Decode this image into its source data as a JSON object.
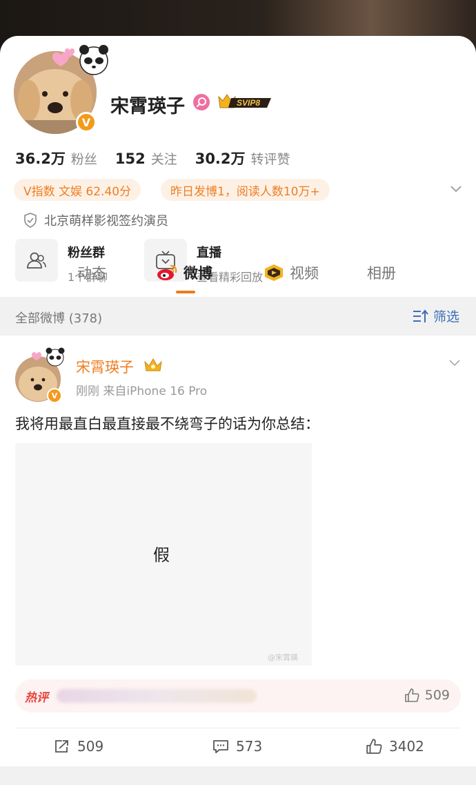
{
  "profile": {
    "name": "宋霄瑛子",
    "verify_badge": "V",
    "svip_label": "SVIP8",
    "stats": [
      {
        "value": "36.2万",
        "label": "粉丝"
      },
      {
        "value": "152",
        "label": "关注"
      },
      {
        "value": "30.2万",
        "label": "转评赞"
      }
    ],
    "pills": [
      "V指数 文娱 62.40分",
      "昨日发博1，阅读人数10万+"
    ],
    "verification": "北京萌样影视签约演员",
    "features": [
      {
        "title": "粉丝群",
        "subtitle": "1个群聊",
        "icon": "fan-group-icon"
      },
      {
        "title": "直播",
        "subtitle": "查看精彩回放",
        "icon": "live-tv-icon"
      }
    ]
  },
  "tabs": [
    {
      "label": "动态"
    },
    {
      "label": "微博"
    },
    {
      "label": "视频"
    },
    {
      "label": "相册"
    }
  ],
  "filter": {
    "count_label": "全部微博 (378)",
    "button_label": "筛选"
  },
  "post": {
    "author": "宋霄瑛子",
    "meta": "刚刚  来自iPhone 16 Pro",
    "text": "我将用最直白最直接最不绕弯子的话为你总结：",
    "image_text": "假",
    "watermark": "@宋霄瑛",
    "hot_label": "热评",
    "hot_like_count": "509",
    "repost_count": "509",
    "comment_count": "573",
    "like_count": "3402"
  },
  "colors": {
    "accent": "#ee7e22",
    "link": "#3c6fb8",
    "hot": "#e8443a"
  }
}
